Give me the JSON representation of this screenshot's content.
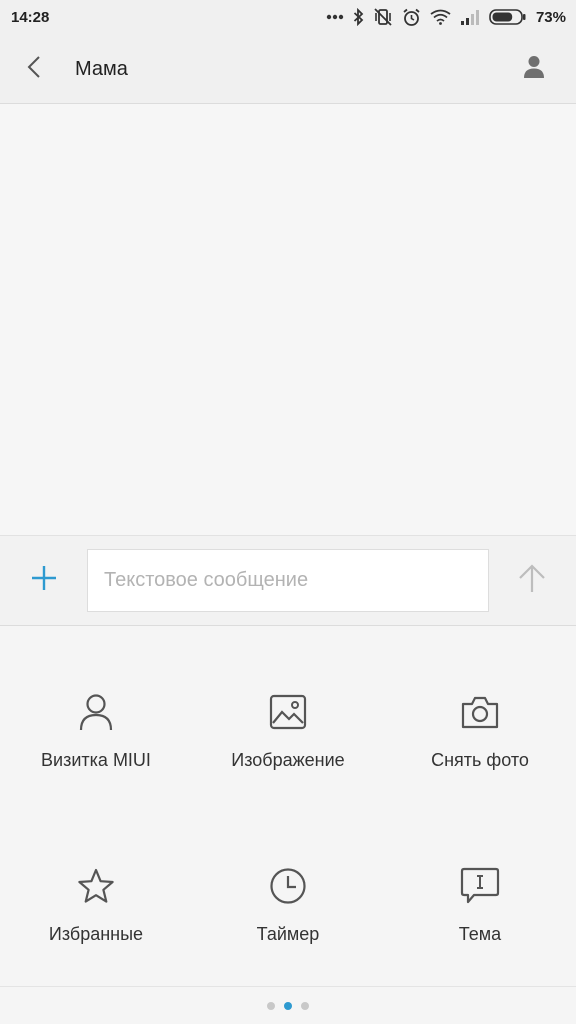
{
  "status_bar": {
    "time": "14:28",
    "battery_percent": "73%",
    "battery_level": 0.73,
    "icons": [
      "more-dots-icon",
      "bluetooth-icon",
      "vibrate-off-icon",
      "alarm-icon",
      "wifi-icon",
      "signal-icon",
      "battery-icon"
    ]
  },
  "header": {
    "title": "Мама",
    "back_icon": "back-arrow-icon",
    "contact_icon": "person-icon"
  },
  "compose": {
    "placeholder": "Текстовое сообщение",
    "value": "",
    "attach_icon": "plus-icon",
    "send_icon": "send-arrow-icon",
    "accent_color": "#2e9ad0"
  },
  "attachments": {
    "items": [
      {
        "label": "Визитка MIUI",
        "icon": "contact-card-icon"
      },
      {
        "label": "Изображение",
        "icon": "image-icon"
      },
      {
        "label": "Снять фото",
        "icon": "camera-icon"
      },
      {
        "label": "Избранные",
        "icon": "star-icon"
      },
      {
        "label": "Таймер",
        "icon": "clock-icon"
      },
      {
        "label": "Тема",
        "icon": "subject-icon"
      }
    ],
    "pages": 3,
    "current_page": 2
  }
}
